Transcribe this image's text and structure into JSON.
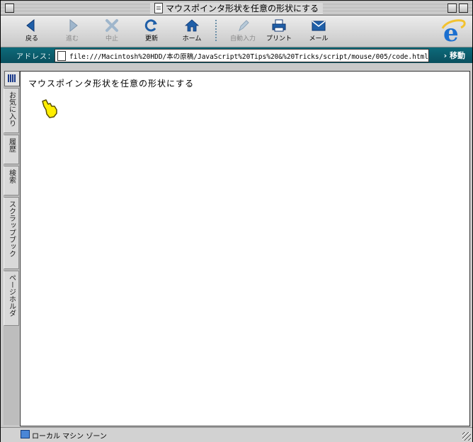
{
  "window": {
    "title": "マウスポインタ形状を任意の形状にする"
  },
  "toolbar": {
    "buttons": [
      {
        "label": "戻る",
        "icon": "back-arrow-icon",
        "enabled": true
      },
      {
        "label": "進む",
        "icon": "forward-arrow-icon",
        "enabled": false
      },
      {
        "label": "中止",
        "icon": "stop-x-icon",
        "enabled": false
      },
      {
        "label": "更新",
        "icon": "refresh-icon",
        "enabled": true
      },
      {
        "label": "ホーム",
        "icon": "home-icon",
        "enabled": true
      },
      {
        "label": "自動入力",
        "icon": "autofill-pen-icon",
        "enabled": false
      },
      {
        "label": "プリント",
        "icon": "printer-icon",
        "enabled": true
      },
      {
        "label": "メール",
        "icon": "mail-icon",
        "enabled": true
      }
    ],
    "logo": "internet-explorer-e-logo"
  },
  "address": {
    "label": "アドレス：",
    "url": "file:///Macintosh%20HDD/本の原稿/JavaScript%20Tips%20&%20Tricks/script/mouse/005/code.html",
    "go_label": "移動"
  },
  "sidebar": {
    "tabs": [
      "お気に入り",
      "履歴",
      "検索",
      "スクラップブック",
      "ページホルダ"
    ]
  },
  "page": {
    "heading": "マウスポインタ形状を任意の形状にする",
    "cursor_color": "#ffee00"
  },
  "status": {
    "zone": "ローカル マシン ゾーン"
  },
  "colors": {
    "accent": "#0c6a7a",
    "icon_blue": "#1f5fa8"
  }
}
